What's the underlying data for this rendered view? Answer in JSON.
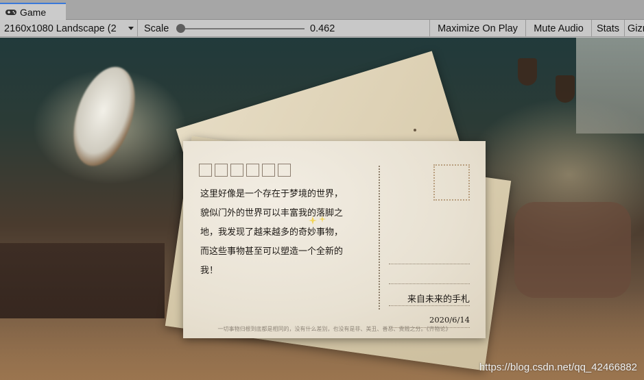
{
  "tab": {
    "label": "Game",
    "icon": "gamepad-icon"
  },
  "toolbar": {
    "resolution": "2160x1080 Landscape (2",
    "scale_label": "Scale",
    "scale_value": "0.462",
    "scale_slider_fraction": 0.0,
    "maximize_on_play": "Maximize On Play",
    "mute_audio": "Mute Audio",
    "stats": "Stats",
    "gizmos": "Gizmos"
  },
  "postcard": {
    "message_lines": [
      "这里好像是一个存在于梦境的世界，",
      "貌似门外的世界可以丰富我的落脚之",
      "地，我发现了越来越多的奇妙事物，",
      "而这些事物甚至可以塑造一个全新的",
      "我！"
    ],
    "sender": "来自未来的手札",
    "date": "2020/6/14",
    "quote": "一切事物归根到底都是相同的，没有什么差别，也没有是非、美丑、善恶、贵贱之分。《齐物论》"
  },
  "watermark": "https://blog.csdn.net/qq_42466882"
}
